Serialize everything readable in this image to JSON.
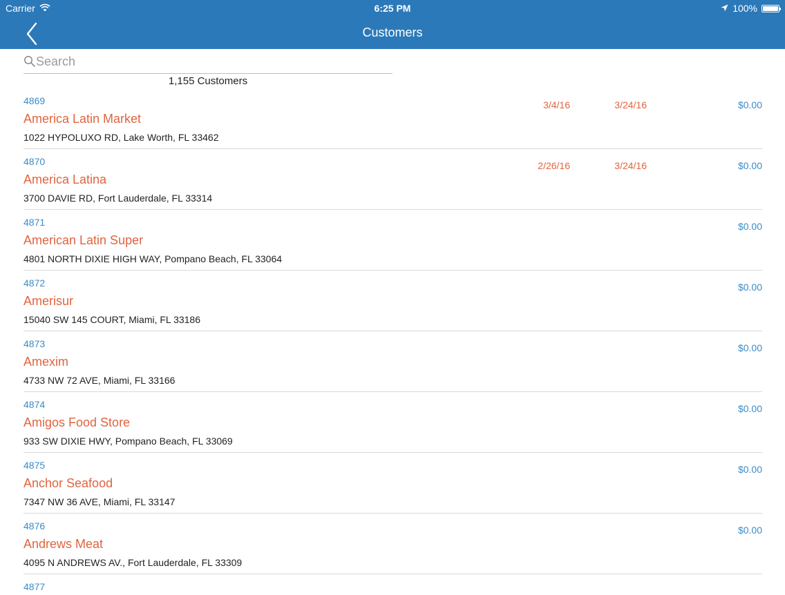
{
  "status_bar": {
    "carrier": "Carrier",
    "time": "6:25 PM",
    "battery": "100%",
    "icons": [
      "wifi-icon",
      "location-arrow-icon",
      "battery-icon"
    ]
  },
  "nav": {
    "title": "Customers",
    "back_icon": "chevron-left-icon"
  },
  "search": {
    "placeholder": "Search",
    "icon": "search-icon"
  },
  "count_label": "1,155 Customers",
  "colors": {
    "header": "#2b79b9",
    "accent_blue": "#3a8bc6",
    "accent_orange": "#e0643e"
  },
  "customers": [
    {
      "id": "4869",
      "name": "America Latin Market",
      "address": "1022 HYPOLUXO RD, Lake Worth, FL 33462",
      "date1": "3/4/16",
      "date2": "3/24/16",
      "amount": "$0.00"
    },
    {
      "id": "4870",
      "name": "America Latina",
      "address": "3700 DAVIE RD, Fort Lauderdale, FL 33314",
      "date1": "2/26/16",
      "date2": "3/24/16",
      "amount": "$0.00"
    },
    {
      "id": "4871",
      "name": "American Latin Super",
      "address": "4801 NORTH DIXIE HIGH WAY, Pompano Beach, FL 33064",
      "date1": "",
      "date2": "",
      "amount": "$0.00"
    },
    {
      "id": "4872",
      "name": "Amerisur",
      "address": "15040 SW 145 COURT, Miami, FL 33186",
      "date1": "",
      "date2": "",
      "amount": "$0.00"
    },
    {
      "id": "4873",
      "name": "Amexim",
      "address": "4733 NW 72 AVE, Miami, FL 33166",
      "date1": "",
      "date2": "",
      "amount": "$0.00"
    },
    {
      "id": "4874",
      "name": "Amigos Food Store",
      "address": "933 SW DIXIE HWY, Pompano Beach, FL 33069",
      "date1": "",
      "date2": "",
      "amount": "$0.00"
    },
    {
      "id": "4875",
      "name": "Anchor Seafood",
      "address": "7347 NW 36 AVE, Miami, FL 33147",
      "date1": "",
      "date2": "",
      "amount": "$0.00"
    },
    {
      "id": "4876",
      "name": "Andrews Meat",
      "address": "4095 N ANDREWS AV., Fort Lauderdale, FL 33309",
      "date1": "",
      "date2": "",
      "amount": "$0.00"
    }
  ],
  "partial_row": {
    "id": "4877"
  }
}
